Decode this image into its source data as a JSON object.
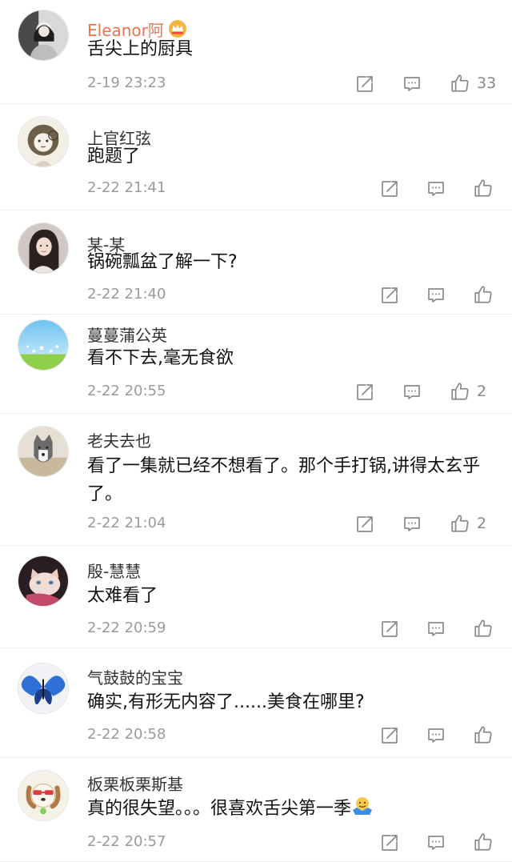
{
  "comments": [
    {
      "author": "Eleanor阿",
      "text": "舌尖上的厨具",
      "time": "2-19 23:23",
      "likes": "33",
      "vip": true,
      "avatar": "girl-bw"
    },
    {
      "author": "上官红弦",
      "text": "跑题了",
      "time": "2-22 21:41",
      "likes": "",
      "avatar": "sketch-girl"
    },
    {
      "author": "某-某",
      "text": "锅碗瓢盆了解一下?",
      "time": "2-22 21:40",
      "likes": "",
      "avatar": "girl-photo"
    },
    {
      "author": "蔓蔓蒲公英",
      "text": "看不下去,毫无食欲",
      "time": "2-22 20:55",
      "likes": "2",
      "avatar": "dandelion"
    },
    {
      "author": "老夫去也",
      "text": "看了一集就已经不想看了。那个手打锅,讲得太玄乎了。",
      "time": "2-22 21:04",
      "likes": "2",
      "avatar": "husky"
    },
    {
      "author": "殷-慧慧",
      "text": "太难看了",
      "time": "2-22 20:59",
      "likes": "",
      "avatar": "cat"
    },
    {
      "author": "气鼓鼓的宝宝",
      "text": "确实,有形无内容了......美食在哪里?",
      "time": "2-22 20:58",
      "likes": "",
      "avatar": "butterfly"
    },
    {
      "author": "板栗板栗斯基",
      "text": "真的很失望。。。很喜欢舌尖第一季",
      "time": "2-22 20:57",
      "likes": "",
      "avatar": "dog-cartoon",
      "emoji": "shrug-emoji"
    }
  ],
  "icons": {
    "repost": "repost-icon",
    "comment": "comment-icon",
    "like": "thumbs-up-icon",
    "vip": "crown-icon"
  },
  "colors": {
    "vip_name": "#eb7350",
    "meta": "#9a9a9a",
    "divider": "#ececec"
  }
}
